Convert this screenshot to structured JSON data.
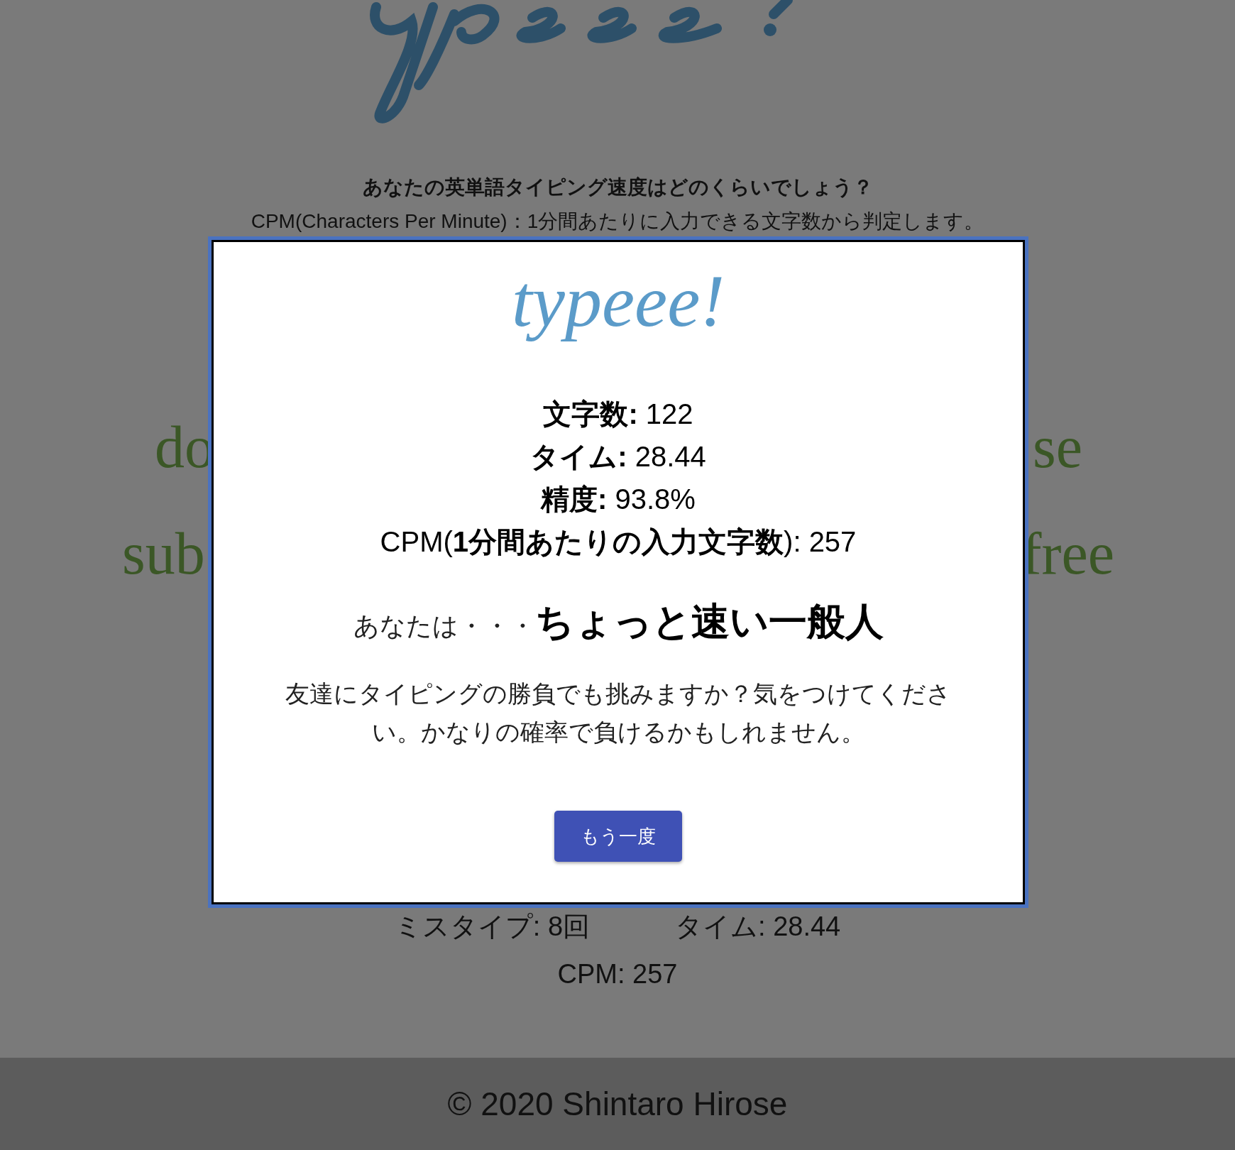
{
  "page": {
    "heading": "あなたの英単語タイピング速度はどのくらいでしょう？",
    "subheading": "CPM(Characters Per Minute)：1分間あたりに入力できる文字数から判定します。",
    "passage_fragments": [
      {
        "left": "do",
        "right": "se"
      },
      {
        "left": "sub",
        "right": "free"
      }
    ],
    "stats": {
      "misses": "ミスタイプ: 8回",
      "time": "タイム: 28.44",
      "cpm": "CPM: 257"
    }
  },
  "result_dialog": {
    "logo": "typeee!",
    "stats": [
      "**文字数:** 122",
      "**タイム:** 28.44",
      "**精度:** 93.8%",
      "CPM(**1分間あたりの入力文字数**): 257"
    ],
    "verdict_prefix": "あなたは・・・",
    "verdict": "ちょっと速い一般人",
    "message": "友達にタイピングの勝負でも挑みますか？気をつけてください。かなりの確率で負けるかもしれません。",
    "button": "もう一度"
  },
  "footer": "© 2020 Shintaro Hirose"
}
